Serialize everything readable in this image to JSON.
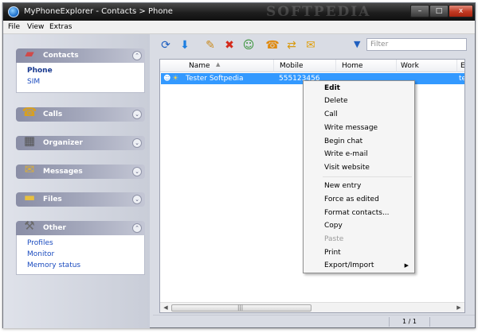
{
  "window": {
    "title": "MyPhoneExplorer -  Contacts > Phone",
    "watermark": "SOFTPEDIA",
    "minimize_glyph": "–",
    "maximize_glyph": "□",
    "close_glyph": "x"
  },
  "menu": [
    "File",
    "View",
    "Extras"
  ],
  "sidebar": {
    "panels": [
      {
        "label": "Contacts",
        "icon": "contacts-book-icon",
        "toggle": "⌃",
        "links": [
          {
            "label": "Phone",
            "active": true
          },
          {
            "label": "SIM",
            "active": false
          }
        ]
      },
      {
        "label": "Calls",
        "icon": "phone-handset-icon",
        "toggle": "⌄",
        "links": []
      },
      {
        "label": "Organizer",
        "icon": "organizer-icon",
        "toggle": "⌄",
        "links": []
      },
      {
        "label": "Messages",
        "icon": "envelope-icon",
        "toggle": "⌄",
        "links": []
      },
      {
        "label": "Files",
        "icon": "folder-icon",
        "toggle": "⌄",
        "links": []
      },
      {
        "label": "Other",
        "icon": "tools-icon",
        "toggle": "⌃",
        "links": [
          {
            "label": "Profiles"
          },
          {
            "label": "Monitor"
          },
          {
            "label": "Memory status"
          }
        ]
      }
    ]
  },
  "toolbar": {
    "buttons": [
      {
        "name": "refresh-sync-icon",
        "glyph": "⟳",
        "color": "#1f5fbf"
      },
      {
        "name": "download-arrow-icon",
        "glyph": "⬇",
        "color": "#1e7fe0"
      },
      {
        "name": "edit-pencil-icon",
        "glyph": "✎",
        "color": "#c98a1d"
      },
      {
        "name": "delete-x-icon",
        "glyph": "✖",
        "color": "#d42a1b"
      },
      {
        "name": "add-contact-icon",
        "glyph": "☺",
        "color": "#2f8f2f"
      },
      {
        "name": "call-phone-icon",
        "glyph": "☎",
        "color": "#e08a10"
      },
      {
        "name": "transfer-arrows-icon",
        "glyph": "⇄",
        "color": "#d89a10"
      },
      {
        "name": "chat-bubble-icon",
        "glyph": "✉",
        "color": "#e0a010"
      }
    ],
    "filter_icon": "funnel-icon",
    "filter_placeholder": "Filter"
  },
  "list": {
    "columns": [
      "Name",
      "Mobile",
      "Home",
      "Work",
      "E"
    ],
    "rows": [
      {
        "name": "Tester Softpedia",
        "mobile": "555123456",
        "home": "",
        "work": "",
        "extra": "te"
      }
    ]
  },
  "status": {
    "page": "1 / 1"
  },
  "context_menu": {
    "items": [
      {
        "label": "Edit",
        "bold": true
      },
      {
        "label": "Delete"
      },
      {
        "label": "Call"
      },
      {
        "label": "Write message"
      },
      {
        "label": "Begin chat"
      },
      {
        "label": "Write e-mail"
      },
      {
        "label": "Visit website"
      },
      {
        "separator": true
      },
      {
        "label": "New entry"
      },
      {
        "label": "Force as edited"
      },
      {
        "label": "Format contacts..."
      },
      {
        "label": "Copy"
      },
      {
        "label": "Paste",
        "disabled": true
      },
      {
        "label": "Print"
      },
      {
        "label": "Export/Import",
        "submenu": true
      }
    ],
    "submenu_glyph": "▶"
  }
}
